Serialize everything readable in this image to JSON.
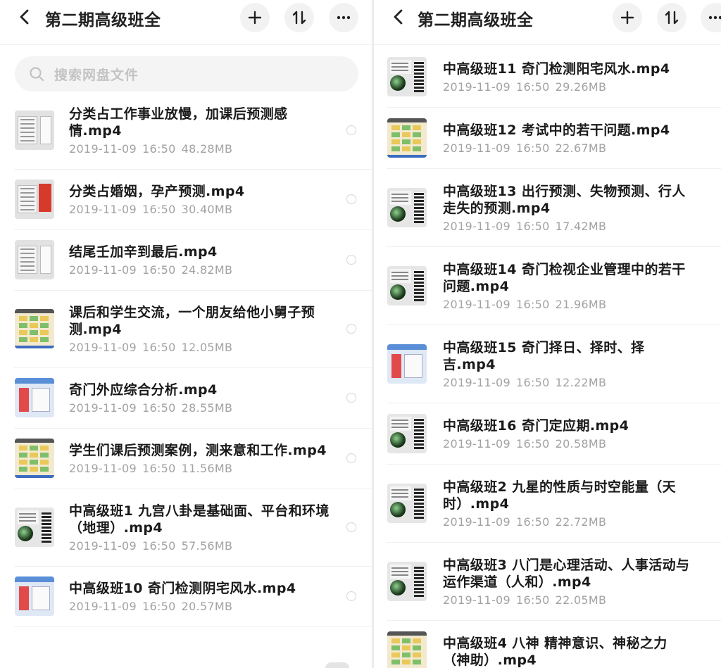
{
  "left": {
    "title": "第二期高级班全",
    "search_placeholder": "搜索网盘文件",
    "files": [
      {
        "name": "分类占工作事业放慢，加课后预测感情.mp4",
        "date": "2019-11-09",
        "time": "16:50",
        "size": "48.28MB",
        "thumb": "doc"
      },
      {
        "name": "分类占婚姻，孕产预测.mp4",
        "date": "2019-11-09",
        "time": "16:50",
        "size": "30.40MB",
        "thumb": "doc-red"
      },
      {
        "name": "结尾壬加辛到最后.mp4",
        "date": "2019-11-09",
        "time": "16:50",
        "size": "24.82MB",
        "thumb": "doc"
      },
      {
        "name": "课后和学生交流，一个朋友给他小舅子预测.mp4",
        "date": "2019-11-09",
        "time": "16:50",
        "size": "12.05MB",
        "thumb": "chart"
      },
      {
        "name": "奇门外应综合分析.mp4",
        "date": "2019-11-09",
        "time": "16:50",
        "size": "28.55MB",
        "thumb": "window"
      },
      {
        "name": "学生们课后预测案例，测来意和工作.mp4",
        "date": "2019-11-09",
        "time": "16:50",
        "size": "11.56MB",
        "thumb": "chart"
      },
      {
        "name": "中高级班1  九宫八卦是基础面、平台和环境（地理）.mp4",
        "date": "2019-11-09",
        "time": "16:50",
        "size": "57.56MB",
        "thumb": "orb"
      },
      {
        "name": "中高级班10 奇门检测阴宅风水.mp4",
        "date": "2019-11-09",
        "time": "16:50",
        "size": "20.57MB",
        "thumb": "window"
      }
    ]
  },
  "right": {
    "title": "第二期高级班全",
    "files": [
      {
        "name": "中高级班11 奇门检测阳宅风水.mp4",
        "date": "2019-11-09",
        "time": "16:50",
        "size": "29.26MB",
        "thumb": "orb-qr"
      },
      {
        "name": "中高级班12 考试中的若干问题.mp4",
        "date": "2019-11-09",
        "time": "16:50",
        "size": "22.67MB",
        "thumb": "chart"
      },
      {
        "name": "中高级班13  出行预测、失物预测、行人走失的预测.mp4",
        "date": "2019-11-09",
        "time": "16:50",
        "size": "17.42MB",
        "thumb": "orb-qr"
      },
      {
        "name": "中高级班14 奇门检视企业管理中的若干问题.mp4",
        "date": "2019-11-09",
        "time": "16:50",
        "size": "21.96MB",
        "thumb": "orb-qr"
      },
      {
        "name": "中高级班15 奇门择日、择时、择吉.mp4",
        "date": "2019-11-09",
        "time": "16:50",
        "size": "12.22MB",
        "thumb": "window"
      },
      {
        "name": "中高级班16 奇门定应期.mp4",
        "date": "2019-11-09",
        "time": "16:50",
        "size": "20.58MB",
        "thumb": "orb-qr"
      },
      {
        "name": "中高级班2 九星的性质与时空能量（天时）.mp4",
        "date": "2019-11-09",
        "time": "16:50",
        "size": "22.72MB",
        "thumb": "orb-qr"
      },
      {
        "name": "中高级班3 八门是心理活动、人事活动与运作渠道（人和）.mp4",
        "date": "2019-11-09",
        "time": "16:50",
        "size": "22.05MB",
        "thumb": "orb-qr"
      },
      {
        "name": "中高级班4  八神  精神意识、神秘之力（神助）.mp4",
        "date": "",
        "time": "",
        "size": "",
        "thumb": "chart"
      }
    ]
  },
  "colors": {
    "background": "#ffffff",
    "divider": "#ececec",
    "title_text": "#222222",
    "meta_text": "#a2a2a2",
    "button_bg": "#f2f2f2"
  },
  "icons": {
    "back": "chevron-left-icon",
    "add": "plus-icon",
    "sort": "sort-icon",
    "more": "more-icon",
    "search": "search-icon",
    "select": "radio-icon"
  }
}
